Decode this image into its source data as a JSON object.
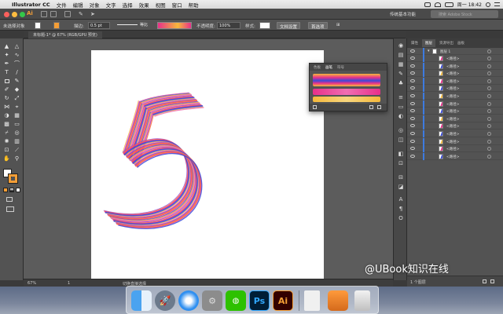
{
  "menubar": {
    "app_name": "Illustrator CC",
    "items": [
      "文件",
      "编辑",
      "对象",
      "文字",
      "选择",
      "效果",
      "视图",
      "窗口",
      "帮助"
    ],
    "clock": "周一 18:42"
  },
  "appbar": {
    "app_logo": "Ai",
    "workspace": "传统基本功能",
    "search_placeholder": "搜索 Adobe Stock"
  },
  "control_bar": {
    "selection_label": "未选择对象",
    "stroke_label": "描边:",
    "stroke_value": "0.5 pt",
    "uniform_label": "等比",
    "opacity_label": "不透明度:",
    "opacity_value": "100%",
    "style_label": "样式:",
    "doc_setup_button": "文档设置",
    "prefs_button": "首选项"
  },
  "document": {
    "tab_title": "未标题-1* @ 67% (RGB/GPU 预览)"
  },
  "brush_panel": {
    "tabs": [
      "色板",
      "画笔",
      "符号"
    ],
    "active_tab": 1
  },
  "layers_panel": {
    "tabs": [
      "属性",
      "图层",
      "资源导出",
      "画板"
    ],
    "active_tab": 1,
    "parent_layer": "图层 1",
    "rows": [
      "<路径>",
      "<路径>",
      "<路径>",
      "<路径>",
      "<路径>",
      "<路径>",
      "<路径>",
      "<路径>",
      "<路径>",
      "<路径>",
      "<路径>",
      "<路径>",
      "<路径>",
      "<路径>"
    ],
    "footer_label": "1 个图层"
  },
  "status_bar": {
    "zoom": "67%",
    "page": "1",
    "tool_hint": "切换直接选择"
  },
  "watermark": "@UBook知识在线",
  "colors": {
    "accent": "#3d7be0",
    "ai_orange": "#f49e36",
    "ps_blue": "#31a8ff",
    "brush_pink": "#e8308a",
    "brush_blue": "#3a4bd8",
    "brush_yellow": "#f6b93b"
  }
}
